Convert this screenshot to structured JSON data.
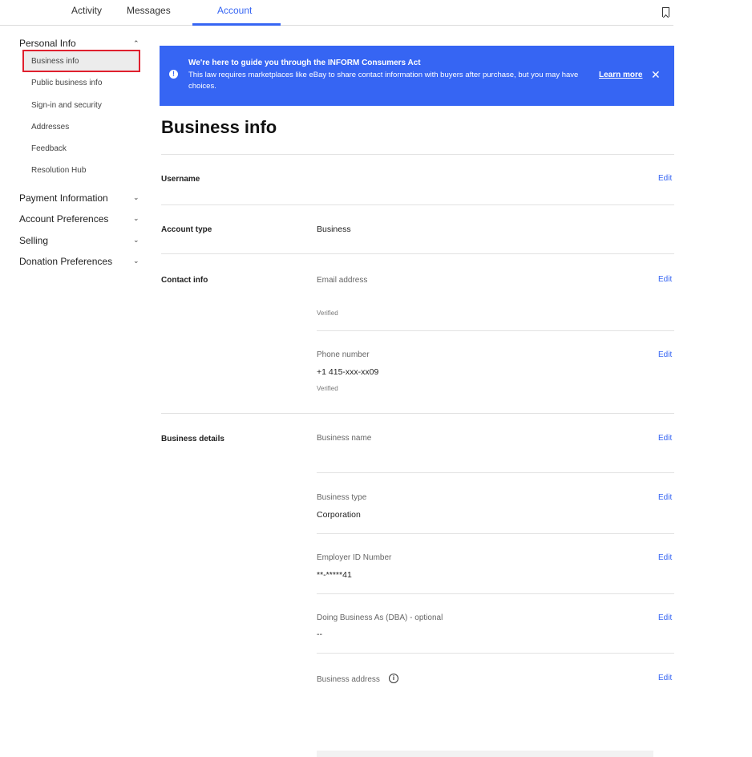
{
  "tabs": {
    "activity": "Activity",
    "messages": "Messages",
    "account": "Account",
    "accent_color": "#3665f3"
  },
  "bookmark_icon": "bookmark-icon",
  "sidebar": {
    "personal_info": "Personal Info",
    "personal_items": {
      "business_info": "Business info",
      "public_business_info": "Public business info",
      "sign_in_security": "Sign-in and security",
      "addresses": "Addresses",
      "feedback": "Feedback",
      "resolution_hub": "Resolution Hub"
    },
    "payment_information": "Payment Information",
    "account_preferences": "Account Preferences",
    "selling": "Selling",
    "donation_preferences": "Donation Preferences",
    "highlight_color": "#e0202e"
  },
  "banner": {
    "title": "We're here to guide you through the INFORM Consumers Act",
    "text": "This law requires marketplaces like eBay to share contact information with buyers after purchase, but you may have choices.",
    "learn_more": "Learn more",
    "close": "✕",
    "info_glyph": "!",
    "color": "#3665f3"
  },
  "page_title": "Business info",
  "sections": {
    "username": {
      "label": "Username",
      "edit": "Edit"
    },
    "account_type": {
      "label": "Account type",
      "value": "Business"
    },
    "contact_info": {
      "label": "Contact info",
      "email_label": "Email address",
      "email_status": "Verified",
      "email_edit": "Edit",
      "phone_label": "Phone number",
      "phone_value": "+1 415-xxx-xx09",
      "phone_status": "Verified",
      "phone_edit": "Edit"
    },
    "business_details": {
      "label": "Business details",
      "name_label": "Business name",
      "name_edit": "Edit",
      "type_label": "Business type",
      "type_value": "Corporation",
      "type_edit": "Edit",
      "ein_label": "Employer ID Number",
      "ein_value": "**-*****41",
      "ein_edit": "Edit",
      "dba_label": "Doing Business As (DBA) - optional",
      "dba_value": "--",
      "dba_edit": "Edit",
      "address_label": "Business address",
      "address_info_glyph": "i",
      "address_edit": "Edit"
    }
  }
}
